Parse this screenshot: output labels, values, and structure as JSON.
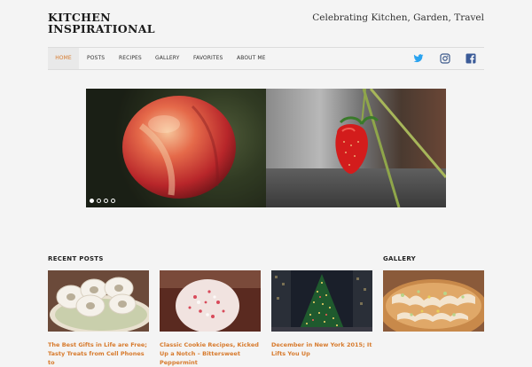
{
  "site": {
    "title": "KITCHEN INSPIRATIONAL",
    "tagline": "Celebrating Kitchen, Garden, Travel"
  },
  "nav": {
    "items": [
      {
        "label": "HOME",
        "active": true
      },
      {
        "label": "POSTS",
        "active": false
      },
      {
        "label": "RECIPES",
        "active": false
      },
      {
        "label": "GALLERY",
        "active": false
      },
      {
        "label": "FAVORITES",
        "active": false
      },
      {
        "label": "ABOUT ME",
        "active": false
      }
    ],
    "social": [
      {
        "icon": "twitter-icon",
        "color": "#2aa3ef"
      },
      {
        "icon": "instagram-icon",
        "color": "#3d5a8c"
      },
      {
        "icon": "facebook-icon",
        "color": "#3b5b98"
      }
    ],
    "accent_color": "#d77a2c"
  },
  "slider": {
    "slides": [
      {
        "subject": "peach"
      },
      {
        "subject": "strawberry"
      }
    ],
    "dots": 4,
    "active_dot": 1
  },
  "recent_posts": {
    "heading": "RECENT POSTS",
    "posts": [
      {
        "title": "The Best Gifts in Life are Free; Tasty Treats from Cell Phones to",
        "image": "powdered-donuts"
      },
      {
        "title": "Classic Cookie Recipes, Kicked Up a Notch – Bittersweet Peppermint",
        "image": "peppermint-cookie"
      },
      {
        "title": "December in New York 2015; It Lifts You Up",
        "image": "christmas-tree"
      }
    ]
  },
  "gallery": {
    "heading": "GALLERY",
    "image": "glazed-cake"
  }
}
